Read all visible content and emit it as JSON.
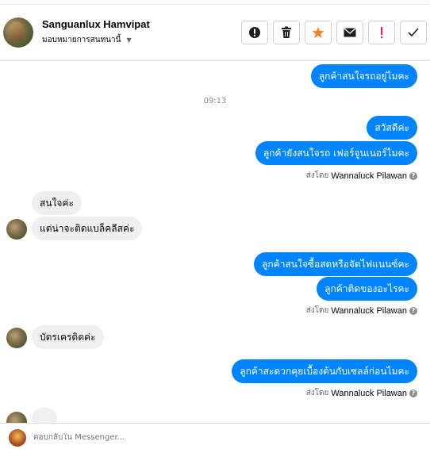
{
  "header": {
    "name": "Sanguanlux Hamvipat",
    "assign_label": "มอบหมายการสนทนานี้",
    "actions": [
      {
        "icon": "exclamation-circle-icon"
      },
      {
        "icon": "trash-icon"
      },
      {
        "icon": "star-icon"
      },
      {
        "icon": "envelope-icon"
      },
      {
        "icon": "exclamation-icon"
      },
      {
        "icon": "check-icon"
      }
    ]
  },
  "thread": {
    "messages": [
      {
        "dir": "out",
        "text": "ลูกค้าสนใจรถอยู่ไมคะ"
      },
      {
        "type": "time",
        "text": "09:13"
      },
      {
        "dir": "out",
        "text": "สวัสดีค่ะ"
      },
      {
        "dir": "out",
        "text": "ลูกค้ายังสนใจรถ เฟอร์จูนเนอร์ไมคะ"
      },
      {
        "type": "sentby",
        "prefix": "ส่งโดย",
        "sender": "Wannaluck Pilawan"
      },
      {
        "dir": "in",
        "text": "สนใจค่ะ"
      },
      {
        "dir": "in",
        "text": "แต่น่าจะติดแบล็คลีสค่ะ"
      },
      {
        "dir": "out",
        "text": "ลูกค้าสนใจซื้อสดหรือจัดไฟแนนซ์คะ"
      },
      {
        "dir": "out",
        "text": "ลูกค้าติดของอะไรคะ"
      },
      {
        "type": "sentby",
        "prefix": "ส่งโดย",
        "sender": "Wannaluck Pilawan"
      },
      {
        "dir": "in",
        "text": "บัตรเครดิตค่ะ"
      },
      {
        "dir": "out",
        "text": "ลูกค้าสะดวกคุยเบื้องต้นกับเซลล์ก่อนไมคะ"
      },
      {
        "type": "sentby",
        "prefix": "ส่งโดย",
        "sender": "Wannaluck Pilawan"
      }
    ]
  },
  "composer": {
    "placeholder": "ตอบกลับใน Messenger..."
  },
  "colors": {
    "outgoing_bubble": "#0084ff",
    "incoming_bubble": "#f0f0f0",
    "star": "#f5821f",
    "alert": "#e0245e"
  }
}
